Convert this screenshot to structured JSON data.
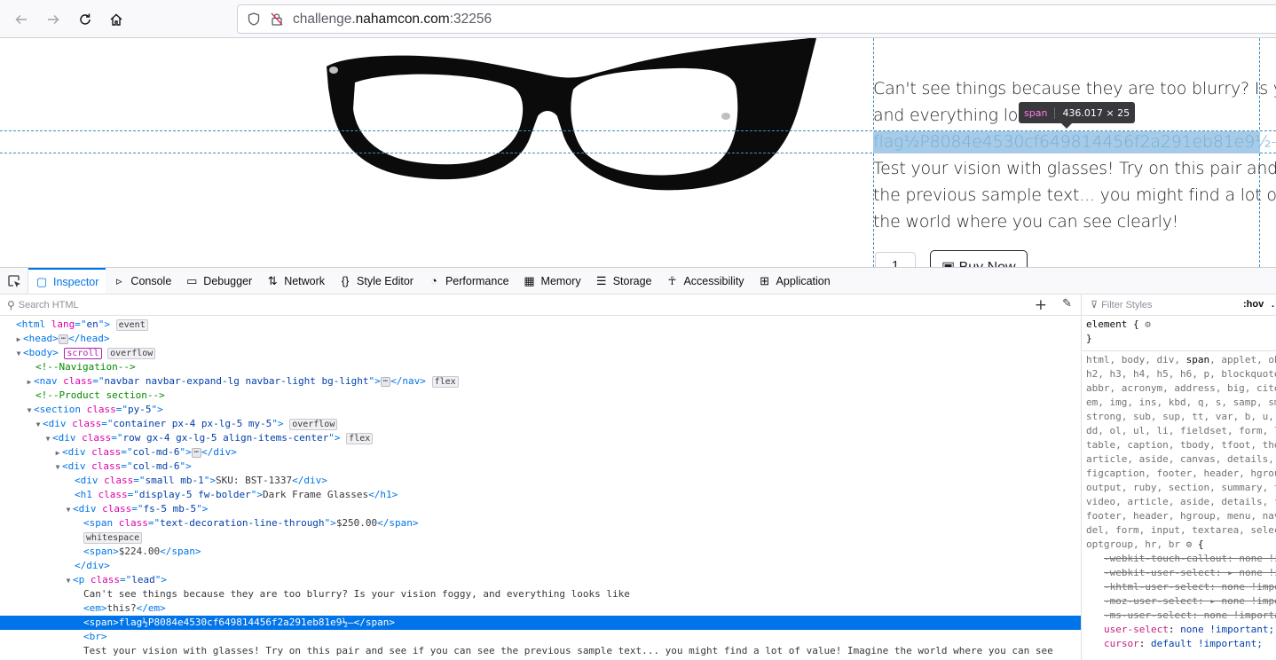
{
  "browser": {
    "url_prefix": "challenge.",
    "url_domain": "nahamcon.com",
    "url_suffix": ":32256"
  },
  "page": {
    "lead_line1": "Can't see things because they are too blurry? Is your",
    "lead_line2": "and everything loo",
    "flag_text": "flag½P8084e4530cf649814456f2a291eb81e9½—",
    "lead_line3": "Test your vision with glasses! Try on this pair and see",
    "lead_line4": "the previous sample text... you might find a lot of val",
    "lead_line5": "the world where you can see clearly!",
    "quantity": "1",
    "buy_label": "Buy Now",
    "tooltip_tag": "span",
    "tooltip_size": "436.017 × 25"
  },
  "devtools": {
    "tabs": [
      {
        "label": "Inspector",
        "icon": "inspector-icon"
      },
      {
        "label": "Console",
        "icon": "console-icon"
      },
      {
        "label": "Debugger",
        "icon": "debugger-icon"
      },
      {
        "label": "Network",
        "icon": "network-icon"
      },
      {
        "label": "Style Editor",
        "icon": "style-editor-icon"
      },
      {
        "label": "Performance",
        "icon": "performance-icon"
      },
      {
        "label": "Memory",
        "icon": "memory-icon"
      },
      {
        "label": "Storage",
        "icon": "storage-icon"
      },
      {
        "label": "Accessibility",
        "icon": "accessibility-icon"
      },
      {
        "label": "Application",
        "icon": "application-icon"
      }
    ],
    "search_placeholder": "Search HTML",
    "filter_placeholder": "Filter Styles",
    "hov_label": ":hov",
    "cls_fragment": ".",
    "tree": {
      "html_lang": "en",
      "badge_event": "event",
      "badge_scroll": "scroll",
      "badge_overflow": "overflow",
      "badge_flex": "flex",
      "badge_whitespace": "whitespace",
      "comment_nav": "<!--Navigation-->",
      "nav_class": "navbar navbar-expand-lg navbar-light bg-light",
      "comment_product": "<!--Product section-->",
      "section_class": "py-5",
      "container_class": "container px-4 px-lg-5 my-5",
      "row_class": "row gx-4 gx-lg-5 align-items-center",
      "col_class": "col-md-6",
      "sku_class": "small mb-1",
      "sku_text": "SKU: BST-1337",
      "h1_class": "display-5 fw-bolder",
      "h1_text": "Dark Frame Glasses",
      "price_class": "fs-5 mb-5",
      "old_price_class": "text-decoration-line-through",
      "old_price": "$250.00",
      "new_price": "$224.00",
      "p_class": "lead",
      "p_text": "Can't see things because they are too blurry? Is your vision foggy, and everything looks like",
      "em_text": "this?",
      "flag_span_text": "flag½P8084e4530cf649814456f2a291eb81e9½—",
      "p_text2": "Test your vision with glasses! Try on this pair and see if you can see the previous sample text... you might find a lot of value! Imagine the world where you can see"
    },
    "rules": {
      "element_rule": "element {",
      "close_brace": "}",
      "selector_lines": [
        "html, body, div, span, applet, ob",
        "h2, h3, h4, h5, h6, p, blockquote",
        "abbr, acronym, address, big, cite",
        "em, img, ins, kbd, q, s, samp, sm",
        "strong, sub, sup, tt, var, b, u,",
        "dd, ol, ul, li, fieldset, form, l",
        "table, caption, tbody, tfoot, the",
        "article, aside, canvas, details,",
        "figcaption, footer, header, hgrou",
        "output, ruby, section, summary, t",
        "video, article, aside, details, f",
        "footer, header, hgroup, menu, nav",
        "del, form, input, textarea, selec"
      ],
      "selector_last": "optgroup, hr, br",
      "declarations": [
        {
          "name": "-webkit-touch-callout",
          "value": "none !i",
          "struck": true
        },
        {
          "name": "-webkit-user-select",
          "value": "▸ none !i",
          "struck": true
        },
        {
          "name": "-khtml-user-select",
          "value": "none !impo",
          "struck": true
        },
        {
          "name": "-moz-user-select",
          "value": "▸ none !impo",
          "struck": true
        },
        {
          "name": "-ms-user-select",
          "value": "none !importa",
          "struck": true
        },
        {
          "name": "user-select",
          "value": "none !important;",
          "struck": false
        },
        {
          "name": "cursor",
          "value": "default !important;",
          "struck": false
        }
      ]
    }
  }
}
